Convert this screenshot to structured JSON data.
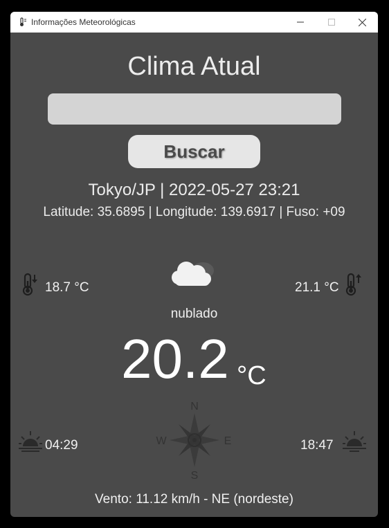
{
  "window": {
    "title": "Informações Meteorológicas",
    "app_icon": "thermometer-app-icon",
    "controls": [
      "minimize-icon",
      "maximize-icon",
      "close-icon"
    ]
  },
  "header": {
    "title": "Clima Atual"
  },
  "search": {
    "value": "",
    "placeholder": "",
    "button_label": "Buscar"
  },
  "location": {
    "title": "Tokyo/JP | 2022-05-27 23:21",
    "coords": "Latitude: 35.6895 | Longitude: 139.6917 | Fuso: +09"
  },
  "weather": {
    "temp_min": "18.7 °C",
    "temp_max": "21.1 °C",
    "condition_icon": "cloud-icon",
    "description": "nublado",
    "temperature": "20.2",
    "unit": "°C",
    "sunrise": "04:29",
    "sunset": "18:47",
    "compass": {
      "n": "N",
      "s": "S",
      "e": "E",
      "w": "W"
    },
    "wind": "Vento: 11.12 km/h - NE (nordeste)"
  },
  "colors": {
    "background": "#4a4a4a",
    "input": "#d4d4d4",
    "button": "#e6e6e6",
    "text": "#ececec"
  }
}
